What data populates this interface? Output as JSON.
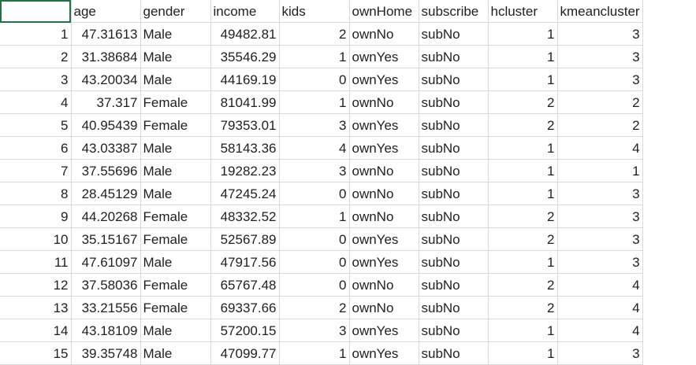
{
  "columns": [
    "",
    "age",
    "gender",
    "income",
    "kids",
    "ownHome",
    "subscribe",
    "hcluster",
    "kmeancluster"
  ],
  "rows": [
    [
      "1",
      "47.31613",
      "Male",
      "49482.81",
      "2",
      "ownNo",
      "subNo",
      "1",
      "3"
    ],
    [
      "2",
      "31.38684",
      "Male",
      "35546.29",
      "1",
      "ownYes",
      "subNo",
      "1",
      "3"
    ],
    [
      "3",
      "43.20034",
      "Male",
      "44169.19",
      "0",
      "ownYes",
      "subNo",
      "1",
      "3"
    ],
    [
      "4",
      "37.317",
      "Female",
      "81041.99",
      "1",
      "ownNo",
      "subNo",
      "2",
      "2"
    ],
    [
      "5",
      "40.95439",
      "Female",
      "79353.01",
      "3",
      "ownYes",
      "subNo",
      "2",
      "2"
    ],
    [
      "6",
      "43.03387",
      "Male",
      "58143.36",
      "4",
      "ownYes",
      "subNo",
      "1",
      "4"
    ],
    [
      "7",
      "37.55696",
      "Male",
      "19282.23",
      "3",
      "ownNo",
      "subNo",
      "1",
      "1"
    ],
    [
      "8",
      "28.45129",
      "Male",
      "47245.24",
      "0",
      "ownNo",
      "subNo",
      "1",
      "3"
    ],
    [
      "9",
      "44.20268",
      "Female",
      "48332.52",
      "1",
      "ownNo",
      "subNo",
      "2",
      "3"
    ],
    [
      "10",
      "35.15167",
      "Female",
      "52567.89",
      "0",
      "ownYes",
      "subNo",
      "2",
      "3"
    ],
    [
      "11",
      "47.61097",
      "Male",
      "47917.56",
      "0",
      "ownYes",
      "subNo",
      "1",
      "3"
    ],
    [
      "12",
      "37.58036",
      "Female",
      "65767.48",
      "0",
      "ownNo",
      "subNo",
      "2",
      "4"
    ],
    [
      "13",
      "33.21556",
      "Female",
      "69337.66",
      "2",
      "ownNo",
      "subNo",
      "2",
      "4"
    ],
    [
      "14",
      "43.18109",
      "Male",
      "57200.15",
      "3",
      "ownYes",
      "subNo",
      "1",
      "4"
    ],
    [
      "15",
      "39.35748",
      "Male",
      "47099.77",
      "1",
      "ownYes",
      "subNo",
      "1",
      "3"
    ]
  ],
  "colors": {
    "selection": "#217346",
    "gridline": "#d9d9d9"
  }
}
